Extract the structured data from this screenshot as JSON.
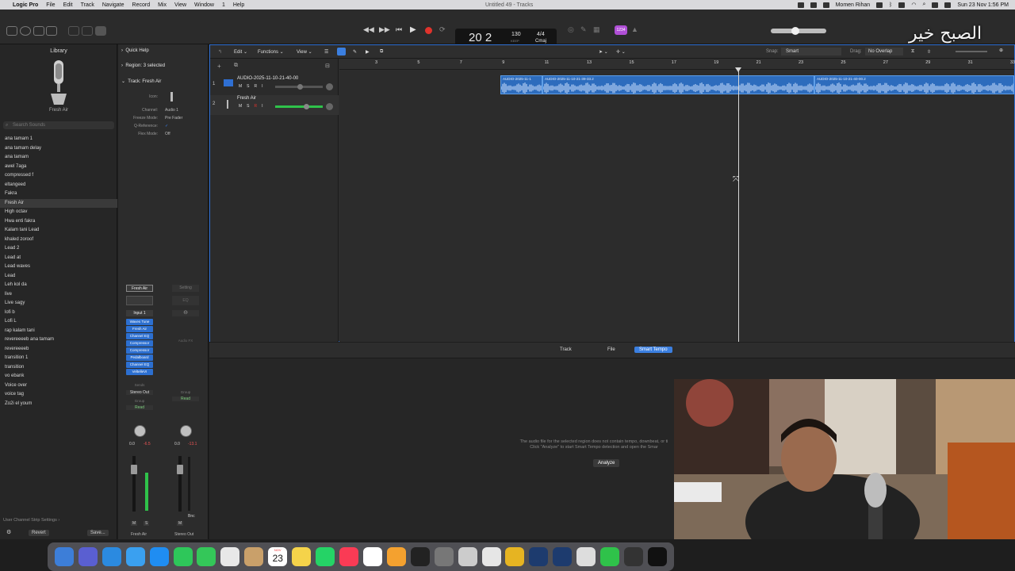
{
  "menubar": {
    "app_name": "Logic Pro",
    "items": [
      "File",
      "Edit",
      "Track",
      "Navigate",
      "Record",
      "Mix",
      "View",
      "Window",
      "1",
      "Help"
    ],
    "window_title": "Untitled 49 - Tracks",
    "user": "Momen Rihan",
    "clock": "Sun 23 Nov 1:56 PM"
  },
  "lcd": {
    "bar": "20",
    "beat": "2",
    "tempo": "130",
    "keep": "KEEP",
    "tempo_label": "TEMPO",
    "signature": "4/4",
    "key": "Cmaj"
  },
  "toolbar": {
    "badge": "1234"
  },
  "watermark": "الصبح خير",
  "library": {
    "title": "Library",
    "preset_name": "Fresh Air",
    "search_placeholder": "Search Sounds",
    "items": [
      "ana tamam 1",
      "ana tamam delay",
      "ana tamam",
      "awel 7aga",
      "compressed f",
      "eltangeed",
      "Fakra",
      "Fresh Air",
      "High octav",
      "Hwa enti fakra",
      "Kalam tani Lead",
      "khaled zoroof",
      "Lead 2",
      "Lead at",
      "Lead waves",
      "Lead",
      "Leh kol da",
      "live",
      "Live sagy",
      "lofi b",
      "Lofi L",
      "rap kalam tani",
      "revereeeeb ana tamam",
      "revereeeeb",
      "transition 1",
      "transition",
      "vo ebank",
      "Voice over",
      "voice tag",
      "Zo2i el youm"
    ],
    "selected": "Fresh Air",
    "footer": "User Channel Strip Settings",
    "revert": "Revert",
    "save": "Save..."
  },
  "inspector": {
    "quick_help": "Quick Help",
    "region": "Region: 3 selected",
    "track": "Track: Fresh Air",
    "rows": [
      {
        "k": "Icon:",
        "v": ""
      },
      {
        "k": "Channel:",
        "v": "Audio 1"
      },
      {
        "k": "Freeze Mode:",
        "v": "Pre Fader"
      },
      {
        "k": "Q-Reference:",
        "v": "✓"
      },
      {
        "k": "Flex Mode:",
        "v": "Off"
      }
    ],
    "strip1": {
      "name": "Fresh Air",
      "input": "Input 1",
      "plugins": [
        "Waves Tune",
        "Fresh Air",
        "Channel EQ",
        "Compressor",
        "Compressor",
        "Pedalboard",
        "Channel EQ",
        "VeltelleVI"
      ],
      "sends": "Sends",
      "output": "Stereo Out",
      "group": "Group",
      "auto": "Read",
      "vol": "0.0",
      "peak": "-6.5",
      "m": "M",
      "s": "S",
      "bottom_name": "Fresh Air"
    },
    "strip2": {
      "name": "Setting",
      "eq": "EQ",
      "audio_fx": "Audio FX",
      "group": "Group",
      "auto": "Read",
      "vol": "0.0",
      "peak": "-13.1",
      "bnc": "Bnc",
      "m": "M",
      "bottom_name": "Stereo Out"
    }
  },
  "tracks_area": {
    "menu": [
      "Edit",
      "Functions",
      "View"
    ],
    "snap_label": "Snap:",
    "snap": "Smart",
    "drag_label": "Drag:",
    "drag": "No Overlap",
    "ruler": [
      "3",
      "5",
      "7",
      "9",
      "11",
      "13",
      "15",
      "17",
      "19",
      "21",
      "23",
      "25",
      "27",
      "29",
      "31",
      "33"
    ],
    "tracks": [
      {
        "num": "1",
        "name": "AUDIO-2025-11-10-21-40-00",
        "btns": [
          "M",
          "S",
          "R",
          "I"
        ]
      },
      {
        "num": "2",
        "name": "Fresh Air",
        "btns": [
          "M",
          "S",
          "R",
          "I"
        ]
      }
    ],
    "regions": [
      "AUDIO-2025-11-1",
      "AUDIO-2025-11-10-21-39-33.2",
      "AUDIO-2025-11-10-21-40-00.2"
    ]
  },
  "editor": {
    "tabs": [
      "Track",
      "File",
      "Smart Tempo"
    ],
    "active_tab": "Smart Tempo",
    "message_line1": "The audio file for the selected region does not contain tempo, downbeat, or ti",
    "message_line2": "Click \"Analyze\" to start Smart Tempo detection and open the Smar",
    "analyze": "Analyze"
  },
  "dock": {
    "calendar_month": "NOV",
    "calendar_day": "23"
  },
  "colors": {
    "accent": "#2f6fd2",
    "region": "#2d6cbd",
    "record": "#e0332c",
    "plugin": "#2c6fd0"
  }
}
